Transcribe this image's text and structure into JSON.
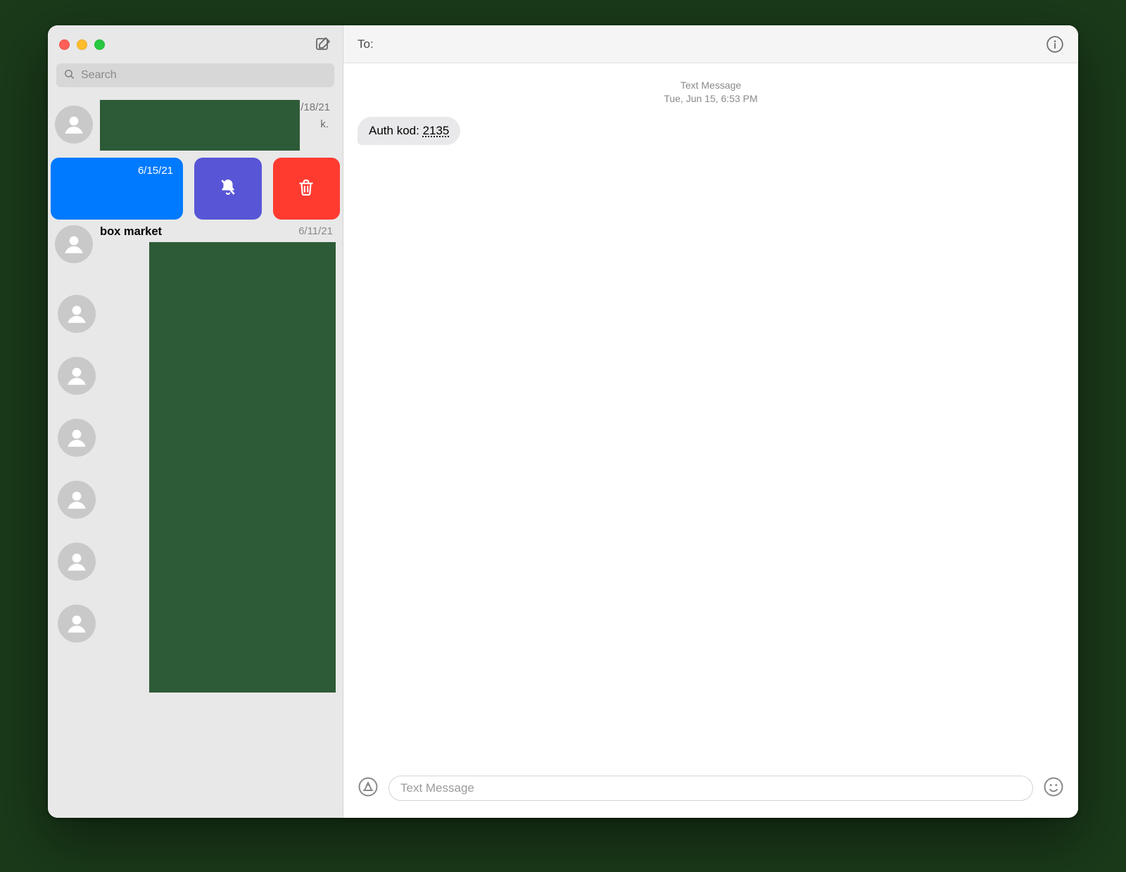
{
  "sidebar": {
    "search_placeholder": "Search",
    "compose_icon": "compose",
    "conversations": [
      {
        "date": "/18/21",
        "preview_tail": "k."
      },
      {
        "date": "6/15/21"
      },
      {
        "title": "box market",
        "date": "6/11/21"
      }
    ]
  },
  "topbar": {
    "to_label": "To:"
  },
  "thread": {
    "kind_label": "Text Message",
    "timestamp": "Tue, Jun 15, 6:53 PM",
    "messages": [
      {
        "text_prefix": "Auth kod:",
        "code": "2135"
      }
    ]
  },
  "composer": {
    "placeholder": "Text Message"
  }
}
